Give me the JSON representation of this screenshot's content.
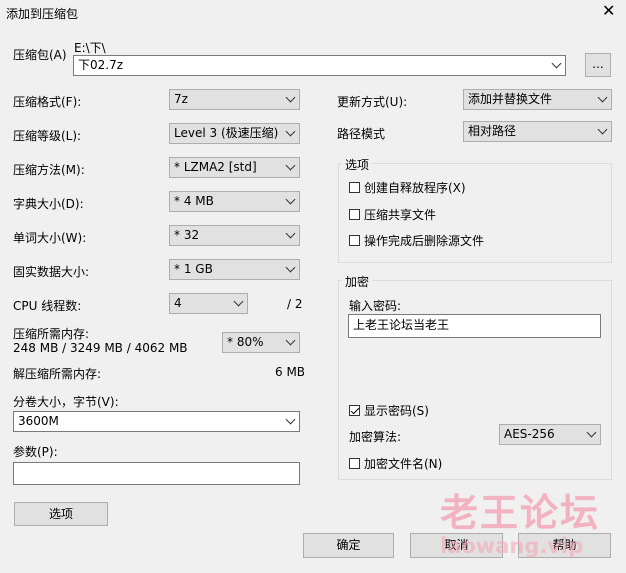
{
  "window": {
    "title": "添加到压缩包"
  },
  "archive": {
    "label": "压缩包(A)",
    "path": "E:\\下\\",
    "filename": "下02.7z",
    "browse_label": "..."
  },
  "left": {
    "format": {
      "label": "压缩格式(F):",
      "value": "7z"
    },
    "level": {
      "label": "压缩等级(L):",
      "value": "Level 3 (极速压缩)"
    },
    "method": {
      "label": "压缩方法(M):",
      "value": "*  LZMA2 [std]"
    },
    "dict": {
      "label": "字典大小(D):",
      "value": "*  4 MB"
    },
    "word": {
      "label": "单词大小(W):",
      "value": "*  32"
    },
    "solid": {
      "label": "固实数据大小:",
      "value": "*  1 GB"
    },
    "cpu": {
      "label": "CPU 线程数:",
      "value": "4",
      "total": "/ 2"
    },
    "mem": {
      "label": "压缩所需内存:",
      "detail": "248 MB / 3249 MB / 4062 MB",
      "value": "* 80%"
    },
    "decomp": {
      "label": "解压缩所需内存:",
      "value": "6 MB"
    },
    "volume": {
      "label": "分卷大小，字节(V):",
      "value": "3600M"
    },
    "params": {
      "label": "参数(P):",
      "value": ""
    },
    "options_button": "选项"
  },
  "right": {
    "update": {
      "label": "更新方式(U):",
      "value": "添加并替换文件"
    },
    "pathmode": {
      "label": "路径模式",
      "value": "相对路径"
    },
    "options": {
      "title": "选项",
      "sfx": "创建自释放程序(X)",
      "shared": "压缩共享文件",
      "delete": "操作完成后删除源文件"
    },
    "encrypt": {
      "title": "加密",
      "pw_label": "输入密码:",
      "password": "上老王论坛当老王",
      "show": "显示密码(S)",
      "algo_label": "加密算法:",
      "algo": "AES-256",
      "names": "加密文件名(N)"
    }
  },
  "buttons": {
    "ok": "确定",
    "cancel": "取消",
    "help": "帮助"
  },
  "watermark": {
    "text": "老王论坛",
    "url": "laowang.vip"
  }
}
